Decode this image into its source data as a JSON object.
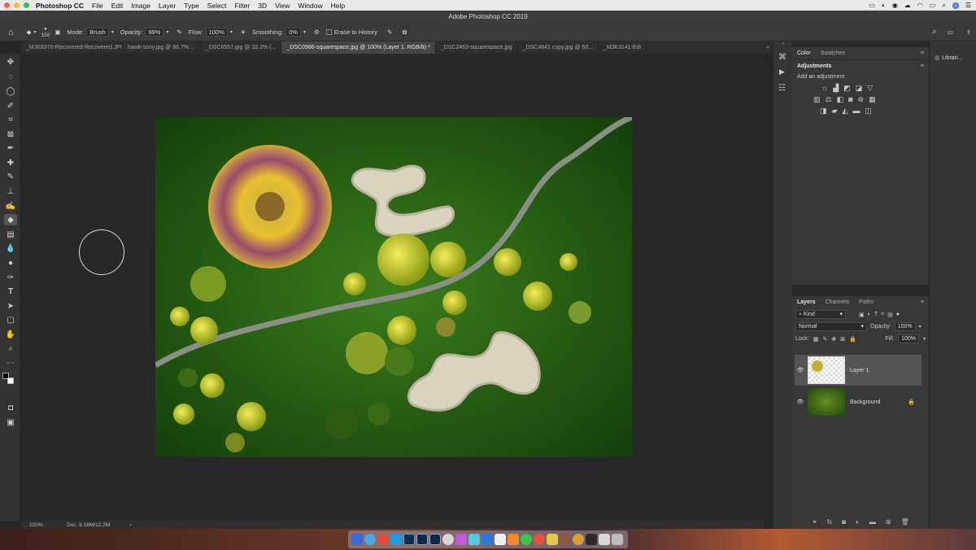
{
  "menubar": {
    "app_name": "Photoshop CC",
    "items": [
      "File",
      "Edit",
      "Image",
      "Layer",
      "Type",
      "Select",
      "Filter",
      "3D",
      "View",
      "Window",
      "Help"
    ]
  },
  "window": {
    "title": "Adobe Photoshop CC 2019"
  },
  "options": {
    "brush_size": "150",
    "mode_label": "Mode:",
    "mode_value": "Brush",
    "opacity_label": "Opacity:",
    "opacity_value": "99%",
    "flow_label": "Flow:",
    "flow_value": "100%",
    "smoothing_label": "Smoothing:",
    "smoothing_value": "0%",
    "erase_history_label": "Erase to History"
  },
  "tabs": [
    {
      "label": "_MJK8370-Recovered-Recovered.JPG",
      "active": false
    },
    {
      "label": "hawk-sony.jpg @ 66.7% ...",
      "active": false
    },
    {
      "label": "_DSC6557.jpg @ 33.3% (...",
      "active": false
    },
    {
      "label": "_DSC0986-squarespace.jpg @ 100% (Layer 1, RGB/8) *",
      "active": true
    },
    {
      "label": "_DSC2463-squarespace.jpg",
      "active": false
    },
    {
      "label": "_DSC4641 copy.jpg @ 50...",
      "active": false
    },
    {
      "label": "_MJK3141-Edi",
      "active": false
    }
  ],
  "status": {
    "zoom": "100%",
    "doc": "Doc: 8.18M/12.2M"
  },
  "panels": {
    "color_tab": "Color",
    "swatches_tab": "Swatches",
    "adjustments_tab": "Adjustments",
    "add_adjustment": "Add an adjustment",
    "layers_tab": "Layers",
    "channels_tab": "Channels",
    "paths_tab": "Paths",
    "kind_filter": "Kind",
    "blend_mode": "Normal",
    "opacity_label": "Opacity:",
    "opacity_value": "100%",
    "lock_label": "Lock:",
    "fill_label": "Fill:",
    "fill_value": "100%",
    "libraries_label": "Librari..."
  },
  "layers": [
    {
      "name": "Layer 1",
      "selected": true
    },
    {
      "name": "Background",
      "selected": false
    }
  ],
  "colors": {
    "accent": "#5a7ec4",
    "canvas_bg": "#282828",
    "panel_bg": "#383838"
  }
}
